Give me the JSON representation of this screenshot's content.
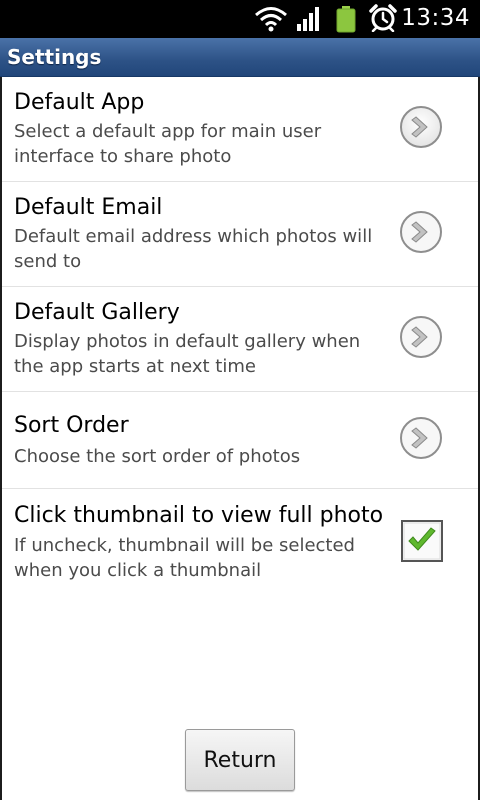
{
  "status_bar": {
    "time": "13:34",
    "icons": [
      "wifi-icon",
      "signal-icon",
      "battery-icon",
      "alarm-icon"
    ]
  },
  "title_bar": {
    "title": "Settings"
  },
  "preferences": [
    {
      "title": "Default App",
      "summary": "Select a default app for main user interface to share photo",
      "widget": "chevron-right-icon"
    },
    {
      "title": "Default Email",
      "summary": "Default email address which photos will send to",
      "widget": "chevron-right-icon"
    },
    {
      "title": "Default Gallery",
      "summary": "Display photos in default gallery when the app starts at next time",
      "widget": "chevron-right-icon"
    },
    {
      "title": "Sort Order",
      "summary": "Choose the sort order of photos",
      "widget": "chevron-right-icon"
    },
    {
      "title": "Click thumbnail to view full photo",
      "summary": "If uncheck, thumbnail will be selected when you click a thumbnail",
      "widget": "checkbox",
      "checked": true
    }
  ],
  "footer": {
    "return_label": "Return"
  },
  "colors": {
    "title_bar": "#2d5286",
    "check_green": "#5fb82e",
    "summary_text": "#4b4b4b"
  }
}
